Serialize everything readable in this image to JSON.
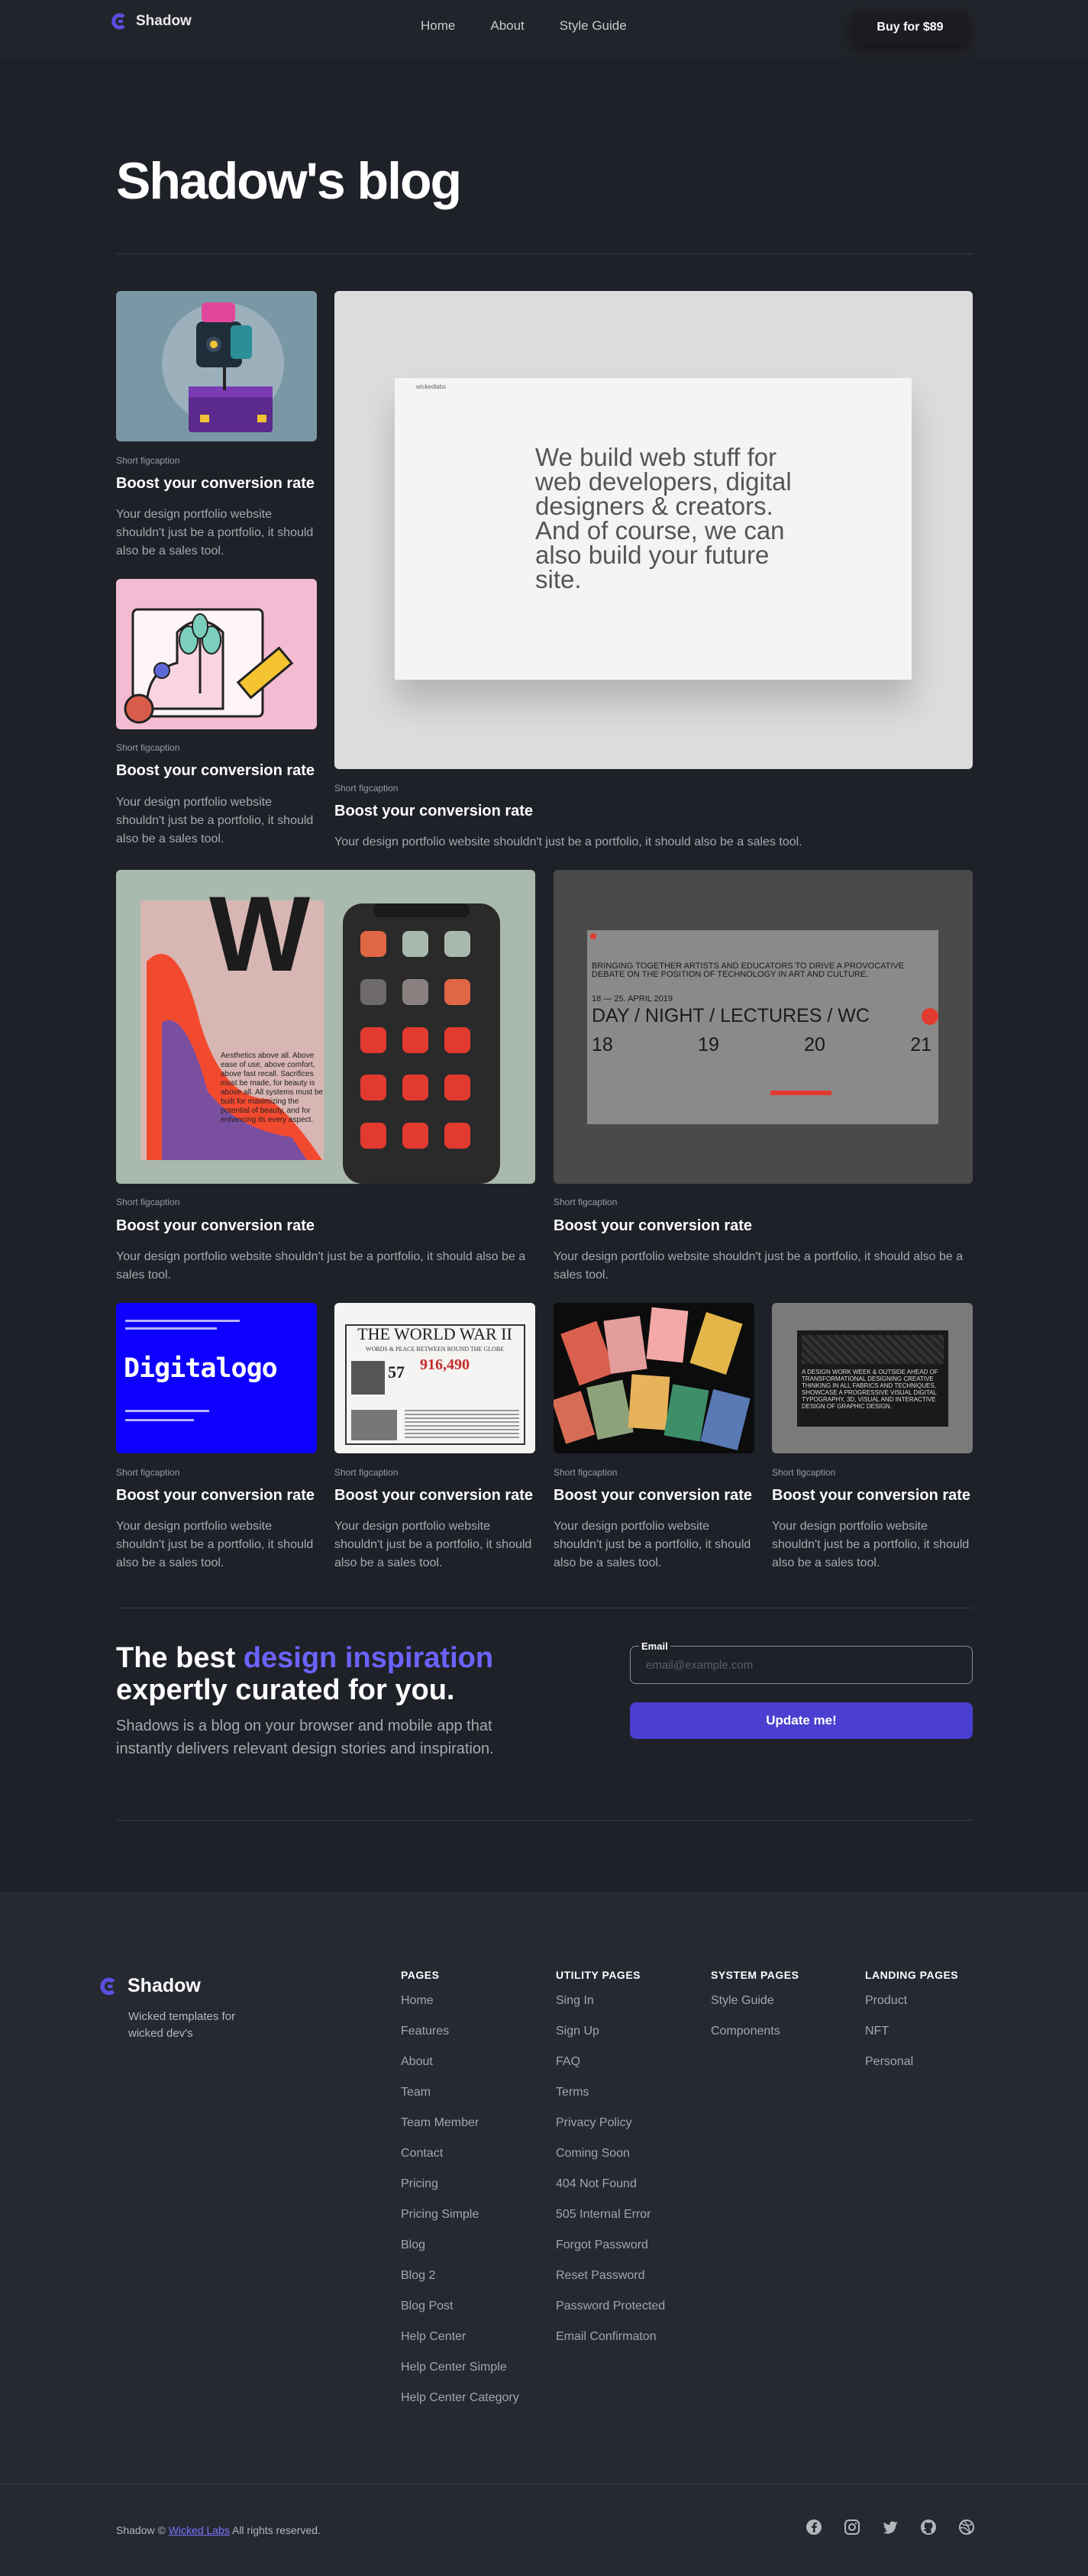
{
  "header": {
    "brand": "Shadow",
    "nav": [
      "Home",
      "About",
      "Style Guide"
    ],
    "buy_label": "Buy for $89"
  },
  "page_title": "Shadow's blog",
  "posts": [
    {
      "figcaption": "Short figcaption",
      "title": "Boost your conversion rate",
      "desc": "Your design portfolio website shouldn't just be a portfolio, it should also be a sales tool."
    },
    {
      "figcaption": "Short figcaption",
      "title": "Boost your conversion rate",
      "desc": "Your design portfolio website shouldn't just be a portfolio, it should also be a sales tool."
    },
    {
      "figcaption": "Short figcaption",
      "title": "Boost your conversion rate",
      "desc": "Your design portfolio website shouldn't just be a portfolio, it should also be a sales tool."
    },
    {
      "figcaption": "Short figcaption",
      "title": "Boost your conversion rate",
      "desc": "Your design portfolio website shouldn't just be a portfolio, it should also be a sales tool."
    },
    {
      "figcaption": "Short figcaption",
      "title": "Boost your conversion rate",
      "desc": "Your design portfolio website shouldn't just be a portfolio, it should also be a sales tool."
    },
    {
      "figcaption": "Short figcaption",
      "title": "Boost your conversion rate",
      "desc": "Your design portfolio website shouldn't just be a portfolio, it should also be a sales tool."
    },
    {
      "figcaption": "Short figcaption",
      "title": "Boost your conversion rate",
      "desc": "Your design portfolio website shouldn't just be a portfolio, it should also be a sales tool."
    },
    {
      "figcaption": "Short figcaption",
      "title": "Boost your conversion rate",
      "desc": "Your design portfolio website shouldn't just be a portfolio, it should also be a sales tool."
    },
    {
      "figcaption": "Short figcaption",
      "title": "Boost your conversion rate",
      "desc": "Your design portfolio website shouldn't just be a portfolio, it should also be a sales tool."
    }
  ],
  "featured_image": {
    "brand": "wickedlabs",
    "headline": "We build web stuff for web developers, digital designers & creators. And of course, we can also build your future site."
  },
  "thumb_text": {
    "art_letter": "W",
    "art_body": "Aesthetics above all. Above ease of use, above comfort, above fast recall. Sacrifices must be made, for beauty is above all. All systems must be built for maximizing the potential of beauty, and for enhancing its every aspect.",
    "event_heading": "BRINGING TOGETHER ARTISTS AND EDUCATORS TO DRIVE A PROVOCATIVE DEBATE ON THE POSITION OF TECHNOLOGY IN ART AND CULTURE.",
    "event_dates": "18 — 25. APRIL 2019",
    "event_words": "DAY / NIGHT / LECTURES / WC",
    "event_days": [
      "18",
      "19",
      "20",
      "21"
    ],
    "digital_word": "Digitalogo",
    "newspaper_title": "THE WORLD WAR II",
    "newspaper_headline": "WORDS & PEACE BETWEEN ROUND THE GLOBE",
    "newspaper_number": "916,490",
    "newspaper_num2": "57",
    "dark_text": "A DESIGN WORK WEEK & OUTSIDE AHEAD OF TRANSFORMATIONAL DESIGNING CREATIVE THINKING IN ALL FABRICS AND TECHNIQUES, SHOWCASE A PROGRESSIVE VISUAL DIGITAL TYPOGRAPHY, 3D, VISUAL AND INTERACTIVE DESIGN OF GRAPHIC DESIGN."
  },
  "newsletter": {
    "title_plain": "The best",
    "title_accent": "design inspiration",
    "title_rest": "expertly curated for you.",
    "text": "Shadows is a blog on your browser and mobile app that instantly delivers relevant design stories and inspiration.",
    "email_label": "Email",
    "email_placeholder": "email@example.com",
    "button_label": "Update me!"
  },
  "footer": {
    "brand": "Shadow",
    "tagline": "Wicked templates for wicked dev's",
    "columns": [
      {
        "heading": "PAGES",
        "links": [
          "Home",
          "Features",
          "About",
          "Team",
          "Team Member",
          "Contact",
          "Pricing",
          "Pricing Simple",
          "Blog",
          "Blog 2",
          "Blog Post",
          "Help Center",
          "Help Center Simple",
          "Help Center Category"
        ]
      },
      {
        "heading": "UTILITY PAGES",
        "links": [
          "Sing In",
          "Sign Up",
          "FAQ",
          "Terms",
          "Privacy Policy",
          "Coming Soon",
          "404 Not Found",
          "505 Internal Error",
          "Forgot Password",
          "Reset Password",
          "Password Protected",
          "Email Confirmaton"
        ]
      },
      {
        "heading": "SYSTEM PAGES",
        "links": [
          "Style Guide",
          "Components"
        ]
      },
      {
        "heading": "LANDING PAGES",
        "links": [
          "Product",
          "NFT",
          "Personal"
        ]
      }
    ],
    "copyright_prefix": "Shadow ©",
    "copyright_brand": "Wicked Labs",
    "copyright_suffix": "All rights reserved.",
    "socials": [
      "facebook-icon",
      "instagram-icon",
      "twitter-icon",
      "github-icon",
      "dribbble-icon"
    ]
  },
  "colors": {
    "background": "#1f2128",
    "accent": "#6c63ff",
    "button": "#4a3fd0"
  }
}
